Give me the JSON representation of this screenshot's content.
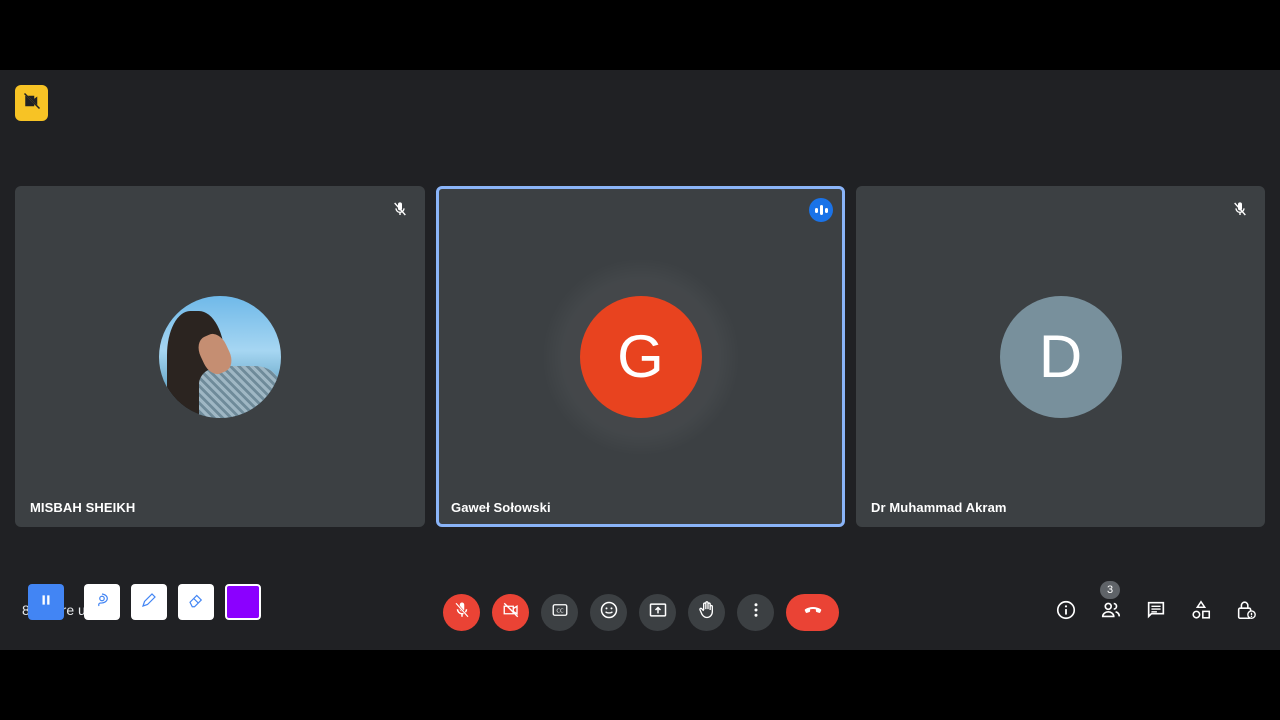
{
  "recording": {
    "icon": "no-video-recording-icon",
    "badge_color": "#f7c325"
  },
  "participants": [
    {
      "name": "MISBAH SHEIKH",
      "avatar_type": "photo",
      "mic": "muted-icon"
    },
    {
      "name": "Gaweł Sołowski",
      "avatar_letter": "G",
      "avatar_color": "#e8431f",
      "status": "speaking-indicator-icon",
      "active": true
    },
    {
      "name": "Dr Muhammad Akram",
      "avatar_letter": "D",
      "avatar_color": "#78909c",
      "mic": "muted-icon"
    }
  ],
  "bottom_left": {
    "obscured_text": "8 AM  fre  uf",
    "tools": [
      "pause-icon",
      "lasso-icon",
      "pen-icon",
      "eraser-icon",
      "color-swatch"
    ],
    "swatch_color": "#8b00ff"
  },
  "controls": [
    "mic-off-icon",
    "camera-off-icon",
    "captions-icon",
    "emoji-icon",
    "present-icon",
    "raise-hand-icon",
    "more-options-icon",
    "end-call-icon"
  ],
  "right_controls": {
    "items": [
      "info-icon",
      "people-icon",
      "chat-icon",
      "activities-icon",
      "host-controls-icon"
    ],
    "people_count": "3"
  }
}
